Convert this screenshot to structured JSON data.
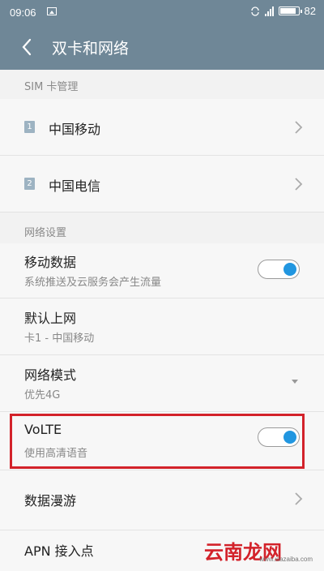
{
  "status_bar": {
    "time": "09:06",
    "battery": "82",
    "battery_fraction": 0.82
  },
  "header": {
    "title": "双卡和网络"
  },
  "sim_section": {
    "header": "SIM 卡管理",
    "items": [
      {
        "badge": "1",
        "label": "中国移动"
      },
      {
        "badge": "2",
        "label": "中国电信"
      }
    ]
  },
  "network_section": {
    "header": "网络设置",
    "mobile_data": {
      "label": "移动数据",
      "sub": "系统推送及云服务会产生流量",
      "enabled": true
    },
    "default_data": {
      "label": "默认上网",
      "sub": "卡1 - 中国移动"
    },
    "network_mode": {
      "label": "网络模式",
      "sub": "优先4G"
    },
    "volte": {
      "label": "VoLTE",
      "sub": "使用高清语音",
      "enabled": true
    },
    "roaming": {
      "label": "数据漫游"
    },
    "apn": {
      "label": "APN 接入点"
    }
  },
  "watermark": {
    "text": "云南龙网",
    "url": "www.xiazaiba.com"
  },
  "colors": {
    "header_bg": "#6f8797",
    "toggle_on": "#2196e0",
    "highlight": "#d3222a"
  }
}
